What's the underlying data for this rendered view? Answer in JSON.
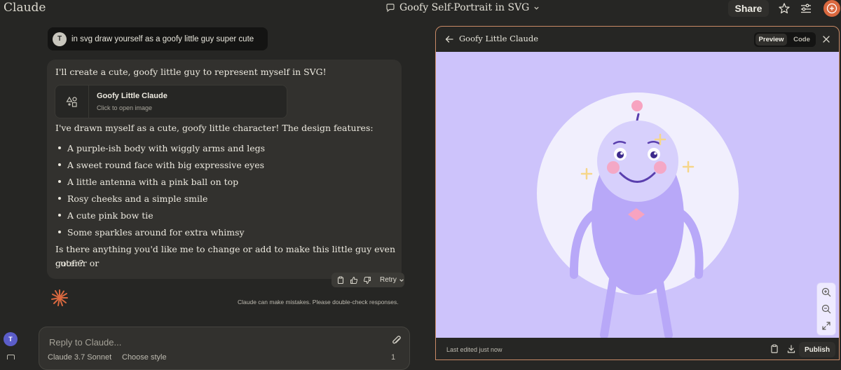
{
  "app": {
    "logo": "Claude"
  },
  "header": {
    "chat_title": "Goofy Self-Portrait in SVG",
    "share_label": "Share"
  },
  "user_message": {
    "avatar_initial": "T",
    "text": "in svg draw yourself as a goofy little guy super cute"
  },
  "assistant": {
    "intro": "I'll create a cute, goofy little guy to represent myself in SVG!",
    "artifact_card": {
      "title": "Goofy Little Claude",
      "subtitle": "Click to open image"
    },
    "features_intro": "I've drawn myself as a cute, goofy little character! The design features:",
    "features": [
      "A purple-ish body with wiggly arms and legs",
      "A sweet round face with big expressive eyes",
      "A little antenna with a pink ball on top",
      "Rosy cheeks and a simple smile",
      "A cute pink bow tie",
      "Some sparkles around for extra whimsy"
    ],
    "outro_line1": "Is there anything you'd like me to change or add to make this little guy even goofier or",
    "outro_line2": "cuter?",
    "retry_label": "Retry",
    "disclaimer": "Claude can make mistakes. Please double-check responses."
  },
  "composer": {
    "placeholder": "Reply to Claude...",
    "model": "Claude 3.7 Sonnet",
    "style": "Choose style",
    "count": "1",
    "bottom_avatar_initial": "T"
  },
  "artifact_panel": {
    "title": "Goofy Little Claude",
    "tabs": {
      "preview": "Preview",
      "code": "Code"
    },
    "active_tab": "Preview",
    "last_edited": "Last edited just now",
    "publish_label": "Publish"
  },
  "colors": {
    "accent_orange": "#d9683f",
    "panel_border": "#c98a66",
    "preview_bg": "#cdc3fb",
    "character_body": "#b8a8f8",
    "character_face": "#d7d0fc",
    "cheeks_and_bowtie": "#f7a3c0",
    "sparkles": "#f6d68a"
  },
  "icons": [
    "chat-bubble-icon",
    "chevron-down-icon",
    "star-icon",
    "settings-sliders-icon",
    "plus-circle-icon",
    "shapes-icon",
    "copy-icon",
    "thumbs-up-icon",
    "thumbs-down-icon",
    "claude-spark-icon",
    "paperclip-icon",
    "arrow-left-icon",
    "close-icon",
    "zoom-in-icon",
    "zoom-out-icon",
    "expand-icon",
    "download-icon"
  ]
}
